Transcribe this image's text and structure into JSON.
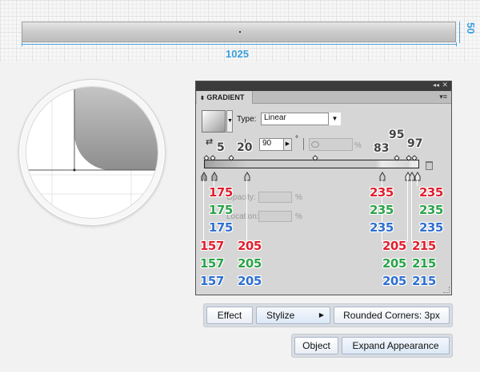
{
  "canvas": {
    "width_label": "1025",
    "height_label": "50"
  },
  "gradient_panel": {
    "tab_title": "GRADIENT",
    "type_label": "Type:",
    "type_value": "Linear",
    "angle_value": "90",
    "angle_unit": "°",
    "percent_sign": "%",
    "opacity_label": "Opacity:",
    "location_label": "Location:",
    "stop_locations": [
      "5",
      "20",
      "83",
      "95",
      "97"
    ]
  },
  "stops": [
    {
      "r": "157",
      "g": "157",
      "b": "157"
    },
    {
      "r": "175",
      "g": "175",
      "b": "175"
    },
    {
      "r": "205",
      "g": "205",
      "b": "205"
    },
    {
      "r": "205",
      "g": "205",
      "b": "205"
    },
    {
      "r": "235",
      "g": "235",
      "b": "235"
    },
    {
      "r": "215",
      "g": "215",
      "b": "215"
    },
    {
      "r": "235",
      "g": "235",
      "b": "235"
    }
  ],
  "menu": {
    "effect": "Effect",
    "stylize": "Stylize",
    "rounded_corners": "Rounded Corners: 3px",
    "object": "Object",
    "expand_appearance": "Expand Appearance"
  },
  "colors": {
    "red": "#e0202e",
    "green": "#2ba34a",
    "blue": "#2e6fd0",
    "dimension": "#3a9fe0"
  }
}
